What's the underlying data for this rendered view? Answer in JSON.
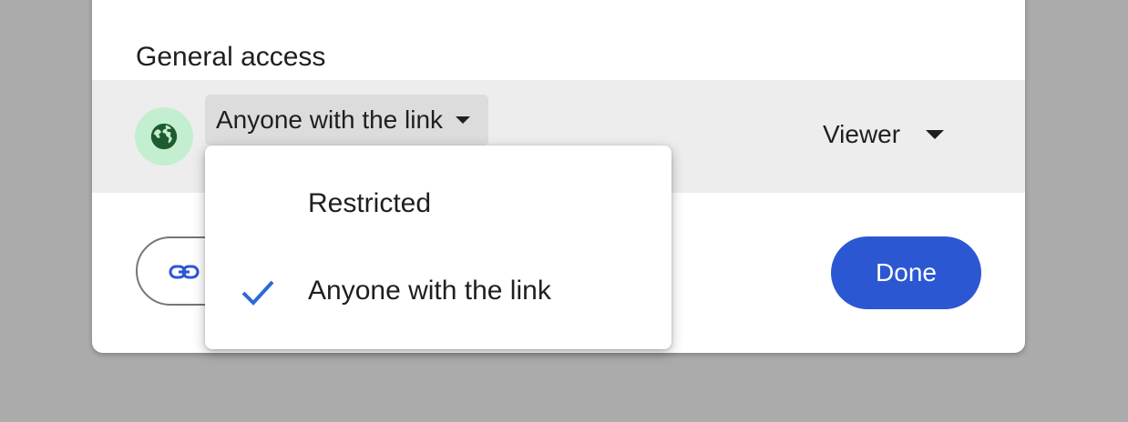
{
  "general_access": {
    "title": "General access",
    "selected_access": "Anyone with the link",
    "role": "Viewer"
  },
  "dropdown": {
    "options": [
      {
        "label": "Restricted",
        "selected": false
      },
      {
        "label": "Anyone with the link",
        "selected": true
      }
    ]
  },
  "footer": {
    "copy_link_icon": "link-icon",
    "done_label": "Done"
  },
  "colors": {
    "backdrop": "#ababab",
    "row_highlight": "#ededed",
    "globe_bg": "#c4eed0",
    "globe_fg": "#1e5b2e",
    "primary": "#2c57d3",
    "check": "#2c6bd6"
  }
}
